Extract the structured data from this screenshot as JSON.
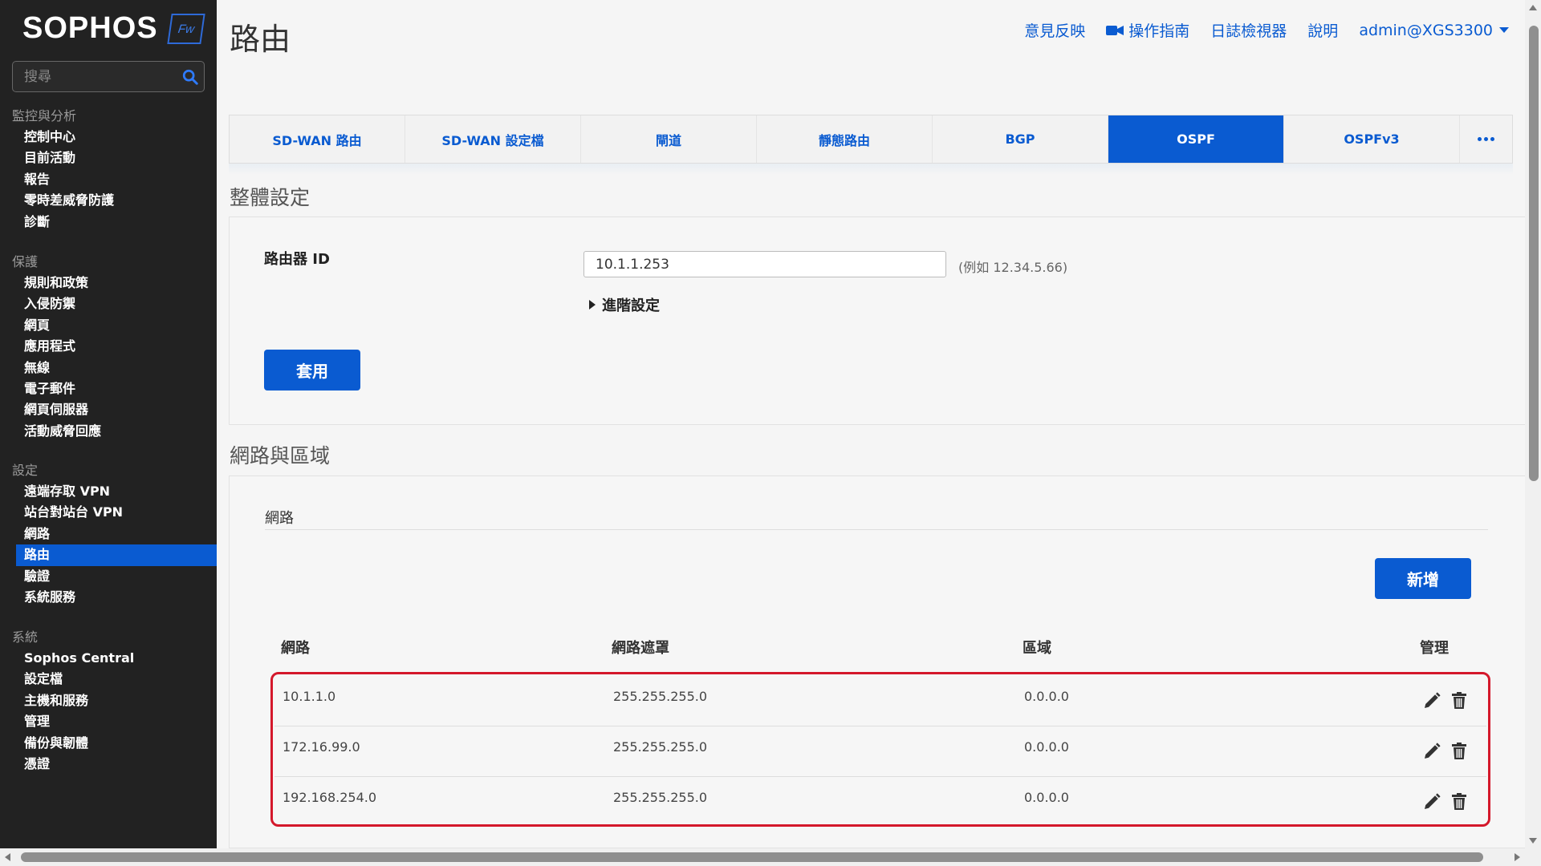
{
  "sidebar": {
    "logo_text": "SOPHOS",
    "logo_badge": "Fw",
    "search_placeholder": "搜尋",
    "sections": [
      {
        "heading": "監控與分析",
        "items": [
          "控制中心",
          "目前活動",
          "報告",
          "零時差威脅防護",
          "診斷"
        ]
      },
      {
        "heading": "保護",
        "items": [
          "規則和政策",
          "入侵防禦",
          "網頁",
          "應用程式",
          "無線",
          "電子郵件",
          "網頁伺服器",
          "活動威脅回應"
        ]
      },
      {
        "heading": "設定",
        "items": [
          "遠端存取 VPN",
          "站台對站台 VPN",
          "網路",
          "路由",
          "驗證",
          "系統服務"
        ]
      },
      {
        "heading": "系統",
        "items": [
          "Sophos Central",
          "設定檔",
          "主機和服務",
          "管理",
          "備份與韌體",
          "憑證"
        ]
      }
    ],
    "active_item": "路由"
  },
  "header": {
    "title": "路由",
    "links": {
      "feedback": "意見反映",
      "guide": "操作指南",
      "log_viewer": "日誌檢視器",
      "help": "說明",
      "user": "admin@XGS3300"
    }
  },
  "tabs": [
    "SD-WAN 路由",
    "SD-WAN 設定檔",
    "閘道",
    "靜態路由",
    "BGP",
    "OSPF",
    "OSPFv3"
  ],
  "active_tab": "OSPF",
  "global_settings": {
    "title": "整體設定",
    "router_id_label": "路由器 ID",
    "router_id_value": "10.1.1.253",
    "router_id_hint": "(例如 12.34.5.66)",
    "advanced_label": "進階設定",
    "apply_label": "套用"
  },
  "network_area": {
    "title": "網路與區域",
    "subhead": "網路",
    "add_label": "新增",
    "columns": {
      "network": "網路",
      "netmask": "網路遮罩",
      "area": "區域",
      "manage": "管理"
    },
    "rows": [
      {
        "network": "10.1.1.0",
        "netmask": "255.255.255.0",
        "area": "0.0.0.0"
      },
      {
        "network": "172.16.99.0",
        "netmask": "255.255.255.0",
        "area": "0.0.0.0"
      },
      {
        "network": "192.168.254.0",
        "netmask": "255.255.255.0",
        "area": "0.0.0.0"
      }
    ]
  },
  "colors": {
    "accent": "#0a5bd1",
    "sidebar_bg": "#222222",
    "highlight": "#d4182b"
  }
}
